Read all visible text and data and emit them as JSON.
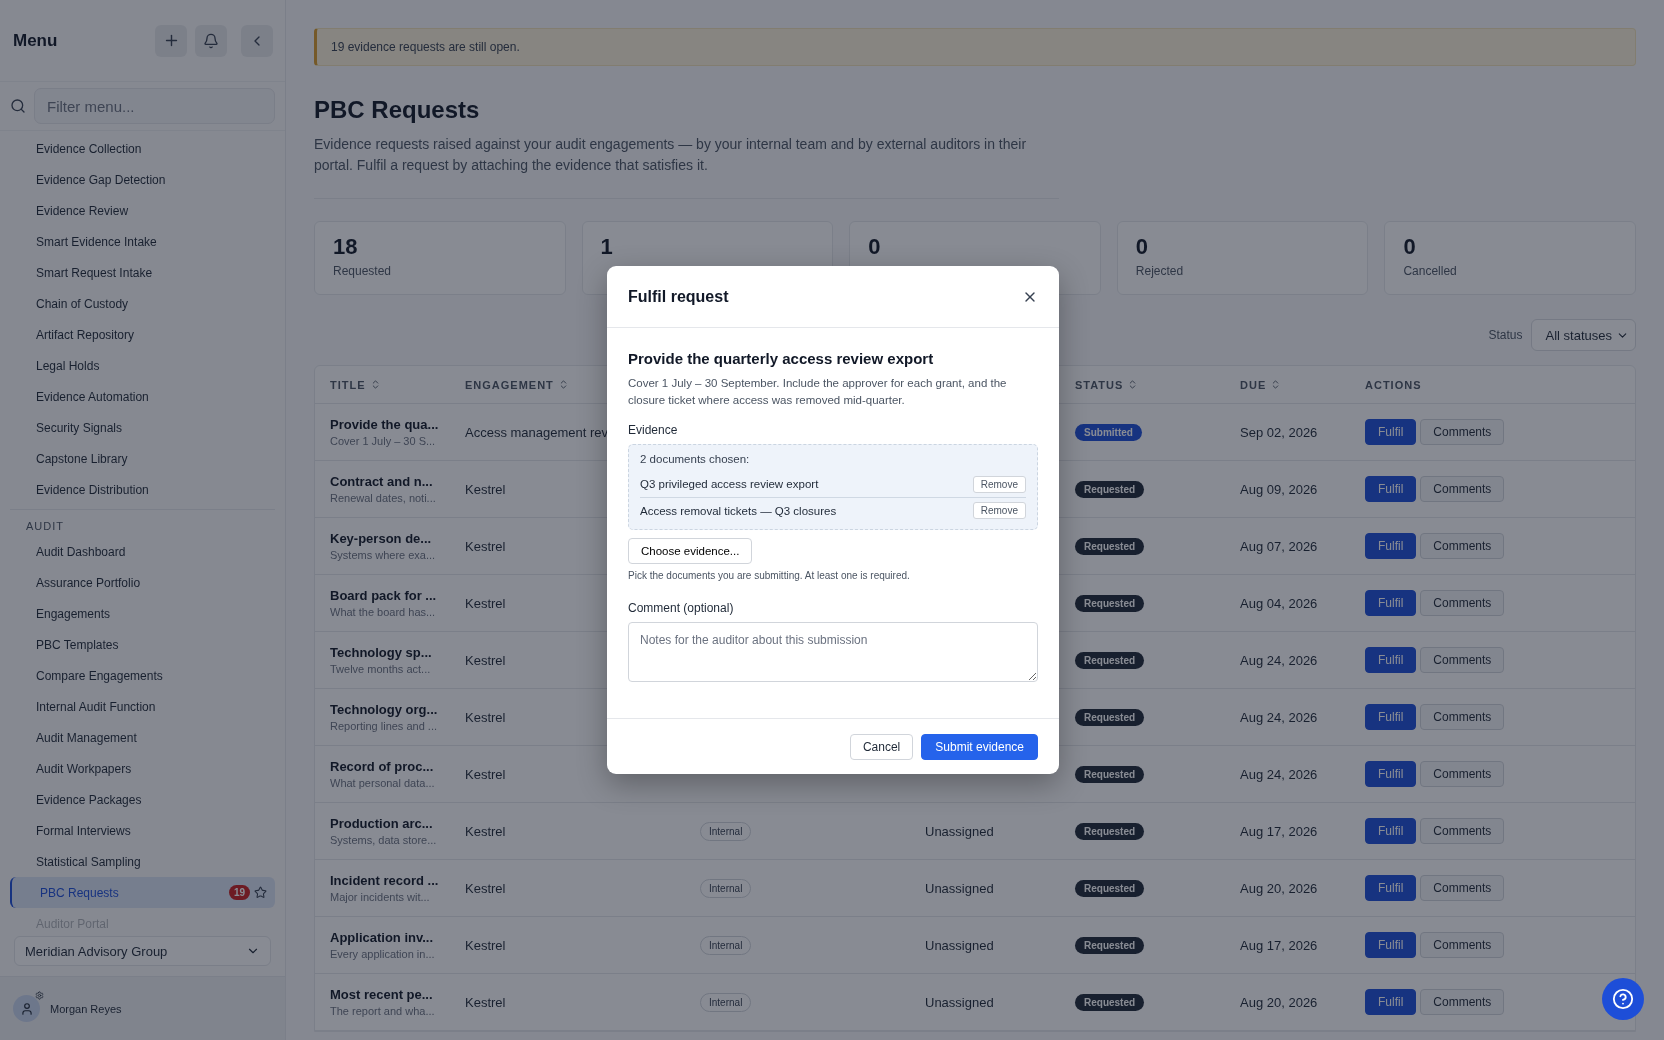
{
  "sidebar": {
    "title": "Menu",
    "filter_placeholder": "Filter menu...",
    "sections": [
      {
        "items": [
          {
            "label": "Evidence Collection",
            "selected": false
          },
          {
            "label": "Evidence Gap Detection",
            "selected": false
          },
          {
            "label": "Evidence Review",
            "selected": false
          },
          {
            "label": "Smart Evidence Intake",
            "selected": false
          },
          {
            "label": "Smart Request Intake",
            "selected": false
          },
          {
            "label": "Chain of Custody",
            "selected": false
          },
          {
            "label": "Artifact Repository",
            "selected": false
          },
          {
            "label": "Legal Holds",
            "selected": false
          },
          {
            "label": "Evidence Automation",
            "selected": false
          },
          {
            "label": "Security Signals",
            "selected": false
          },
          {
            "label": "Capstone Library",
            "selected": false
          },
          {
            "label": "Evidence Distribution",
            "selected": false
          }
        ]
      },
      {
        "heading": "AUDIT",
        "items": [
          {
            "label": "Audit Dashboard",
            "selected": false
          },
          {
            "label": "Assurance Portfolio",
            "selected": false
          },
          {
            "label": "Engagements",
            "selected": false
          },
          {
            "label": "PBC Templates",
            "selected": false
          },
          {
            "label": "Compare Engagements",
            "selected": false
          },
          {
            "label": "Internal Audit Function",
            "selected": false
          },
          {
            "label": "Audit Management",
            "selected": false
          },
          {
            "label": "Audit Workpapers",
            "selected": false
          },
          {
            "label": "Evidence Packages",
            "selected": false
          },
          {
            "label": "Formal Interviews",
            "selected": false
          },
          {
            "label": "Statistical Sampling",
            "selected": false
          },
          {
            "label": "PBC Requests",
            "selected": true,
            "badge": "19",
            "starred": false
          },
          {
            "label": "Auditor Portal",
            "selected": false
          }
        ]
      }
    ],
    "org": "Meridian Advisory Group",
    "user": "Morgan Reyes"
  },
  "banner": "19 evidence requests are still open.",
  "page": {
    "title": "PBC Requests",
    "description": "Evidence requests raised against your audit engagements — by your internal team and by external auditors in their portal. Fulfil a request by attaching the evidence that satisfies it."
  },
  "stats": [
    {
      "value": "18",
      "label": "Requested"
    },
    {
      "value": "1"
    },
    {
      "value": "0"
    },
    {
      "value": "0",
      "label": "Rejected"
    },
    {
      "value": "0",
      "label": "Cancelled"
    }
  ],
  "filter": {
    "label": "Status",
    "value": "All statuses"
  },
  "table": {
    "columns": [
      "TITLE",
      "ENGAGEMENT",
      "STATUS",
      "DUE",
      "ACTIONS"
    ],
    "rows": [
      {
        "title": "Provide the qua...",
        "subtitle": "Cover 1 July – 30 S...",
        "engagement": "Access management rev",
        "status": {
          "label": "Submitted",
          "kind": "submitted"
        },
        "due": "Sep 02, 2026",
        "actions": [
          "Fulfil",
          "Comments"
        ]
      },
      {
        "title": "Contract and n...",
        "subtitle": "Renewal dates, noti...",
        "engagement": "Kestrel",
        "status": {
          "label": "Requested",
          "kind": "requested"
        },
        "due": "Aug 09, 2026",
        "actions": [
          "Fulfil",
          "Comments"
        ]
      },
      {
        "title": "Key-person de...",
        "subtitle": "Systems where exa...",
        "engagement": "Kestrel",
        "status": {
          "label": "Requested",
          "kind": "requested"
        },
        "due": "Aug 07, 2026",
        "actions": [
          "Fulfil",
          "Comments"
        ]
      },
      {
        "title": "Board pack for ...",
        "subtitle": "What the board has...",
        "engagement": "Kestrel",
        "status": {
          "label": "Requested",
          "kind": "requested"
        },
        "due": "Aug 04, 2026",
        "actions": [
          "Fulfil",
          "Comments"
        ]
      },
      {
        "title": "Technology sp...",
        "subtitle": "Twelve months act...",
        "engagement": "Kestrel",
        "status": {
          "label": "Requested",
          "kind": "requested"
        },
        "due": "Aug 24, 2026",
        "actions": [
          "Fulfil",
          "Comments"
        ]
      },
      {
        "title": "Technology org...",
        "subtitle": "Reporting lines and ...",
        "engagement": "Kestrel",
        "status": {
          "label": "Requested",
          "kind": "requested"
        },
        "due": "Aug 24, 2026",
        "actions": [
          "Fulfil",
          "Comments"
        ]
      },
      {
        "title": "Record of proc...",
        "subtitle": "What personal data...",
        "engagement": "Kestrel",
        "status": {
          "label": "Requested",
          "kind": "requested"
        },
        "due": "Aug 24, 2026",
        "actions": [
          "Fulfil",
          "Comments"
        ]
      },
      {
        "title": "Production arc...",
        "subtitle": "Systems, data store...",
        "engagement": "Kestrel",
        "type": "Internal",
        "owner": "Unassigned",
        "status": {
          "label": "Requested",
          "kind": "requested"
        },
        "due": "Aug 17, 2026",
        "actions": [
          "Fulfil",
          "Comments"
        ]
      },
      {
        "title": "Incident record ...",
        "subtitle": "Major incidents wit...",
        "engagement": "Kestrel",
        "type": "Internal",
        "owner": "Unassigned",
        "status": {
          "label": "Requested",
          "kind": "requested"
        },
        "due": "Aug 20, 2026",
        "actions": [
          "Fulfil",
          "Comments"
        ]
      },
      {
        "title": "Application inv...",
        "subtitle": "Every application in...",
        "engagement": "Kestrel",
        "type": "Internal",
        "owner": "Unassigned",
        "status": {
          "label": "Requested",
          "kind": "requested"
        },
        "due": "Aug 17, 2026",
        "actions": [
          "Fulfil",
          "Comments"
        ]
      },
      {
        "title": "Most recent pe...",
        "subtitle": "The report and wha...",
        "engagement": "Kestrel",
        "type": "Internal",
        "owner": "Unassigned",
        "status": {
          "label": "Requested",
          "kind": "requested"
        },
        "due": "Aug 20, 2026",
        "actions": [
          "Fulfil",
          "Comments"
        ]
      }
    ]
  },
  "modal": {
    "title": "Fulfil request",
    "heading": "Provide the quarterly access review export",
    "description": "Cover 1 July – 30 September. Include the approver for each grant, and the closure ticket where access was removed mid-quarter.",
    "evidence_label": "Evidence",
    "chosen_summary": "2 documents chosen:",
    "documents": [
      {
        "name": "Q3 privileged access review export",
        "action": "Remove"
      },
      {
        "name": "Access removal tickets — Q3 closures",
        "action": "Remove"
      }
    ],
    "choose_button": "Choose evidence...",
    "hint": "Pick the documents you are submitting. At least one is required.",
    "comment_label": "Comment (optional)",
    "comment_placeholder": "Notes for the auditor about this submission",
    "buttons": [
      {
        "label": "Cancel",
        "kind": "secondary"
      },
      {
        "label": "Submit evidence",
        "kind": "primary"
      }
    ]
  }
}
